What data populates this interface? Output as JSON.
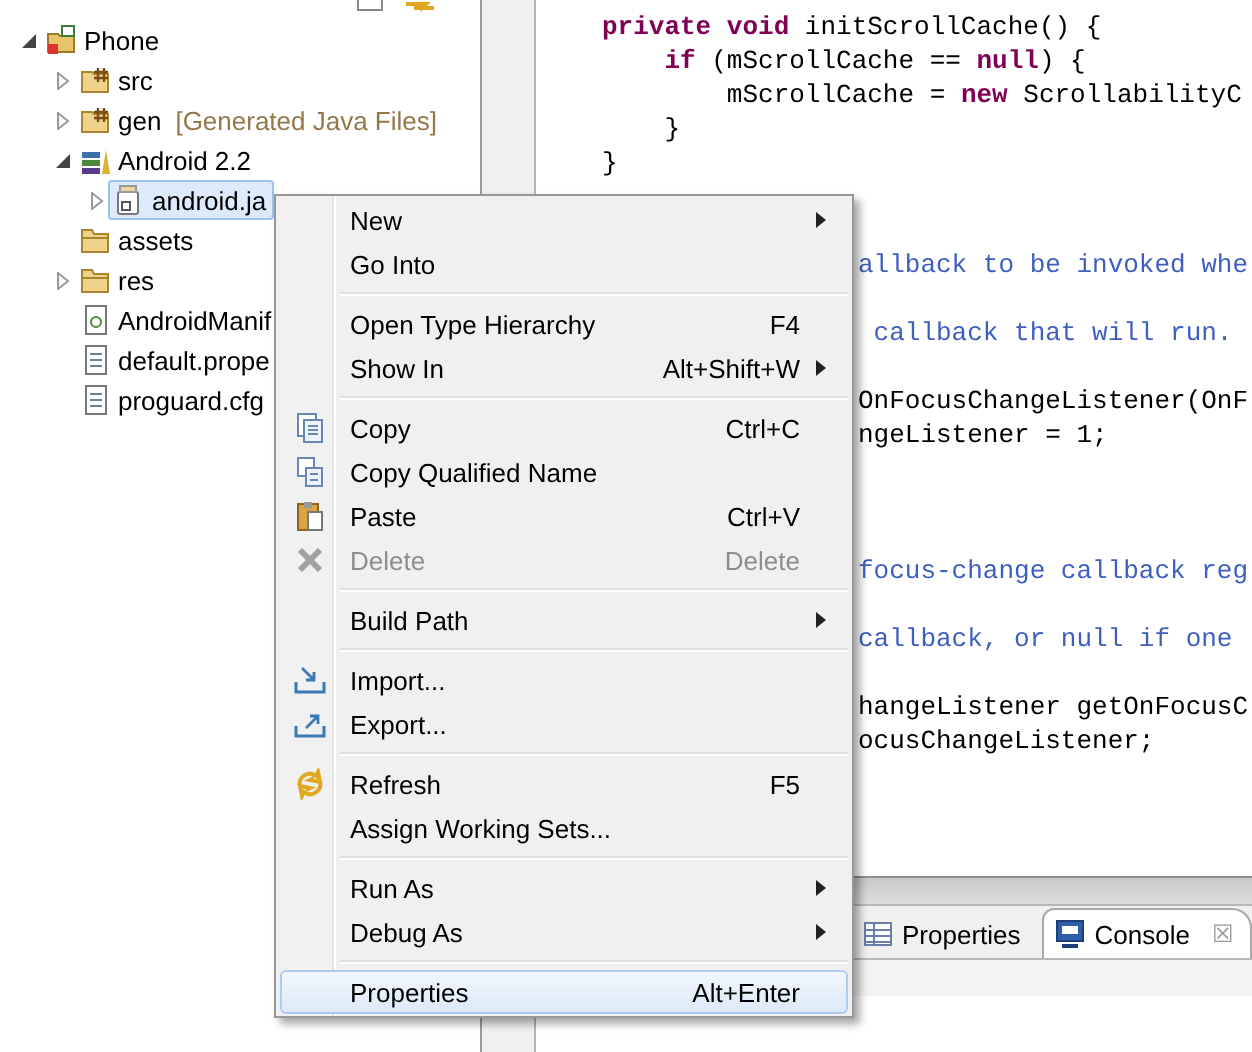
{
  "explorer": {
    "tree": [
      {
        "label": "Phone",
        "kind": "project",
        "expanded": true,
        "selected": false,
        "children": [
          {
            "label": "src",
            "kind": "source",
            "expanded": false,
            "selected": false
          },
          {
            "label": "gen",
            "decoration": "[Generated Java Files]",
            "kind": "source",
            "expanded": false,
            "selected": false
          },
          {
            "label": "Android 2.2",
            "kind": "library",
            "expanded": true,
            "selected": false,
            "children": [
              {
                "label": "android.ja",
                "kind": "jar",
                "expanded": false,
                "selected": true
              }
            ]
          },
          {
            "label": "assets",
            "kind": "folder",
            "selected": false
          },
          {
            "label": "res",
            "kind": "folder",
            "expanded": false,
            "selected": false
          },
          {
            "label": "AndroidManif",
            "kind": "manifest",
            "selected": false
          },
          {
            "label": "default.prope",
            "kind": "file",
            "selected": false
          },
          {
            "label": "proguard.cfg",
            "kind": "file",
            "selected": false
          }
        ]
      }
    ]
  },
  "editor": {
    "lines": [
      {
        "kind": "code",
        "tokens": [
          {
            "text": "private void ",
            "kind": "keyword"
          },
          {
            "text": "initScrollCache() {",
            "kind": "plain"
          }
        ]
      },
      {
        "kind": "code",
        "tokens": [
          {
            "text": "    if ",
            "kind": "keyword"
          },
          {
            "text": "(mScrollCache == ",
            "kind": "plain"
          },
          {
            "text": "null",
            "kind": "keyword"
          },
          {
            "text": ") {",
            "kind": "plain"
          }
        ]
      },
      {
        "kind": "code",
        "tokens": [
          {
            "text": "        mScrollCache = ",
            "kind": "plain"
          },
          {
            "text": "new ",
            "kind": "keyword"
          },
          {
            "text": "ScrollabilityC",
            "kind": "plain"
          }
        ]
      },
      {
        "kind": "code",
        "tokens": [
          {
            "text": "    }",
            "kind": "plain"
          }
        ]
      },
      {
        "kind": "code",
        "tokens": [
          {
            "text": "}",
            "kind": "plain"
          }
        ]
      },
      {
        "kind": "blank"
      },
      {
        "kind": "blank"
      },
      {
        "kind": "clipped",
        "tokens": [
          {
            "text": "allback to be invoked whe",
            "kind": "comment"
          }
        ]
      },
      {
        "kind": "blank"
      },
      {
        "kind": "clipped",
        "tokens": [
          {
            "text": " callback that will run.",
            "kind": "comment"
          }
        ]
      },
      {
        "kind": "blank"
      },
      {
        "kind": "clipped",
        "tokens": [
          {
            "text": "OnFocusChangeListener(OnF",
            "kind": "plain"
          }
        ]
      },
      {
        "kind": "clipped",
        "tokens": [
          {
            "text": "ngeListener = 1;",
            "kind": "plain"
          }
        ]
      },
      {
        "kind": "blank"
      },
      {
        "kind": "blank"
      },
      {
        "kind": "blank"
      },
      {
        "kind": "clipped",
        "tokens": [
          {
            "text": "focus-change callback reg",
            "kind": "comment"
          }
        ]
      },
      {
        "kind": "blank"
      },
      {
        "kind": "clipped",
        "tokens": [
          {
            "text": "callback, or null if one",
            "kind": "comment"
          }
        ]
      },
      {
        "kind": "blank"
      },
      {
        "kind": "clipped",
        "tokens": [
          {
            "text": "hangeListener getOnFocusC",
            "kind": "plain"
          }
        ]
      },
      {
        "kind": "clipped",
        "tokens": [
          {
            "text": "ocusChangeListener;",
            "kind": "plain"
          }
        ]
      }
    ]
  },
  "bottom_panel": {
    "tabs": [
      {
        "label": "Properties",
        "kind": "properties",
        "selected": false
      },
      {
        "label": "Console",
        "kind": "console",
        "selected": true,
        "close": "☒"
      }
    ]
  },
  "context_menu": {
    "items": [
      {
        "kind": "plain",
        "label": "New",
        "submenu": true,
        "disabled": false,
        "selected": false
      },
      {
        "kind": "plain",
        "label": "Go Into",
        "submenu": false,
        "disabled": false,
        "selected": false
      },
      {
        "kind": "separator"
      },
      {
        "kind": "plain",
        "label": "Open Type Hierarchy",
        "shortcut": "F4",
        "submenu": false,
        "disabled": false,
        "selected": false
      },
      {
        "kind": "plain",
        "label": "Show In",
        "shortcut": "Alt+Shift+W",
        "submenu": true,
        "disabled": false,
        "selected": false
      },
      {
        "kind": "separator"
      },
      {
        "kind": "copy",
        "label": "Copy",
        "shortcut": "Ctrl+C",
        "submenu": false,
        "disabled": false,
        "selected": false
      },
      {
        "kind": "copy-qualified",
        "label": "Copy Qualified Name",
        "submenu": false,
        "disabled": false,
        "selected": false
      },
      {
        "kind": "paste",
        "label": "Paste",
        "shortcut": "Ctrl+V",
        "submenu": false,
        "disabled": false,
        "selected": false
      },
      {
        "kind": "delete",
        "label": "Delete",
        "shortcut": "Delete",
        "submenu": false,
        "disabled": true,
        "selected": false
      },
      {
        "kind": "separator"
      },
      {
        "kind": "plain",
        "label": "Build Path",
        "submenu": true,
        "disabled": false,
        "selected": false
      },
      {
        "kind": "separator"
      },
      {
        "kind": "import",
        "label": "Import...",
        "submenu": false,
        "disabled": false,
        "selected": false
      },
      {
        "kind": "export",
        "label": "Export...",
        "submenu": false,
        "disabled": false,
        "selected": false
      },
      {
        "kind": "separator"
      },
      {
        "kind": "refresh",
        "label": "Refresh",
        "shortcut": "F5",
        "submenu": false,
        "disabled": false,
        "selected": false
      },
      {
        "kind": "plain",
        "label": "Assign Working Sets...",
        "submenu": false,
        "disabled": false,
        "selected": false
      },
      {
        "kind": "separator"
      },
      {
        "kind": "plain",
        "label": "Run As",
        "submenu": true,
        "disabled": false,
        "selected": false
      },
      {
        "kind": "plain",
        "label": "Debug As",
        "submenu": true,
        "disabled": false,
        "selected": false
      },
      {
        "kind": "separator"
      },
      {
        "kind": "plain",
        "label": "Properties",
        "shortcut": "Alt+Enter",
        "submenu": false,
        "disabled": false,
        "selected": true
      }
    ]
  }
}
